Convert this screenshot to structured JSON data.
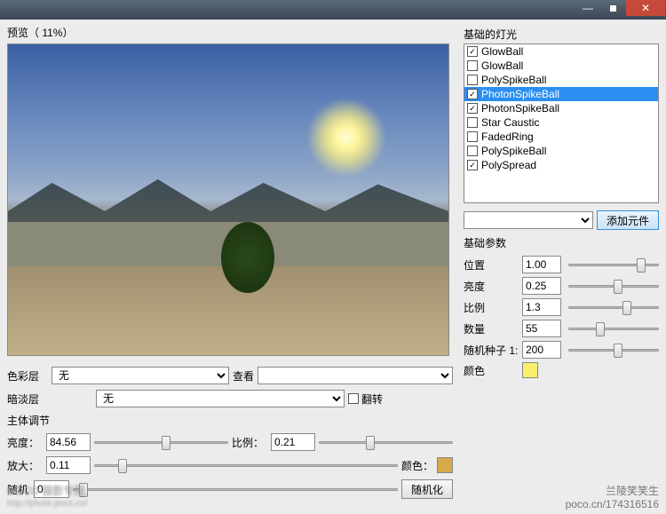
{
  "titlebar": {
    "min": "—",
    "max": "□",
    "close": "✕"
  },
  "preview_label": "预览（ 11%）",
  "left": {
    "color_layer_lbl": "色彩层",
    "color_layer_val": "无",
    "view_lbl": "查看",
    "view_val": "",
    "dark_layer_lbl": "暗淡层",
    "dark_layer_val": "无",
    "flip_lbl": "翻转",
    "subject_adj_lbl": "主体调节",
    "brightness_lbl": "亮度：",
    "brightness_val": "84.56",
    "ratio_lbl": "比例：",
    "ratio_val": "0.21",
    "zoom_lbl": "放大：",
    "zoom_val": "0.11",
    "color_lbl": "颜色：",
    "random_lbl": "随机",
    "random_val": "0",
    "randomize_btn": "随机化"
  },
  "right": {
    "panel_title": "基础的灯光",
    "items": [
      {
        "chk": true,
        "name": "GlowBall",
        "sel": false
      },
      {
        "chk": false,
        "name": "GlowBall",
        "sel": false
      },
      {
        "chk": false,
        "name": "PolySpikeBall",
        "sel": false
      },
      {
        "chk": true,
        "name": "PhotonSpikeBall",
        "sel": true
      },
      {
        "chk": true,
        "name": "PhotonSpikeBall",
        "sel": false
      },
      {
        "chk": false,
        "name": "Star Caustic",
        "sel": false
      },
      {
        "chk": false,
        "name": "FadedRing",
        "sel": false
      },
      {
        "chk": false,
        "name": "PolySpikeBall",
        "sel": false
      },
      {
        "chk": true,
        "name": "PolySpread",
        "sel": false
      }
    ],
    "add_btn": "添加元件",
    "params_title": "基础参数",
    "params": [
      {
        "lbl": "位置",
        "val": "1.00",
        "thumb": 75
      },
      {
        "lbl": "亮度",
        "val": "0.25",
        "thumb": 50
      },
      {
        "lbl": "比例",
        "val": "1.3",
        "thumb": 60
      },
      {
        "lbl": "数量",
        "val": "55",
        "thumb": 30
      },
      {
        "lbl": "随机种子 1:",
        "val": "200",
        "thumb": 50
      }
    ],
    "color_lbl": "颜色"
  },
  "watermark": {
    "big": "DOCO 摄影专题",
    "small": "http://photo.poco.cn/",
    "sig1": "兰陵笑笑生",
    "sig2": "poco.cn/174316516"
  }
}
